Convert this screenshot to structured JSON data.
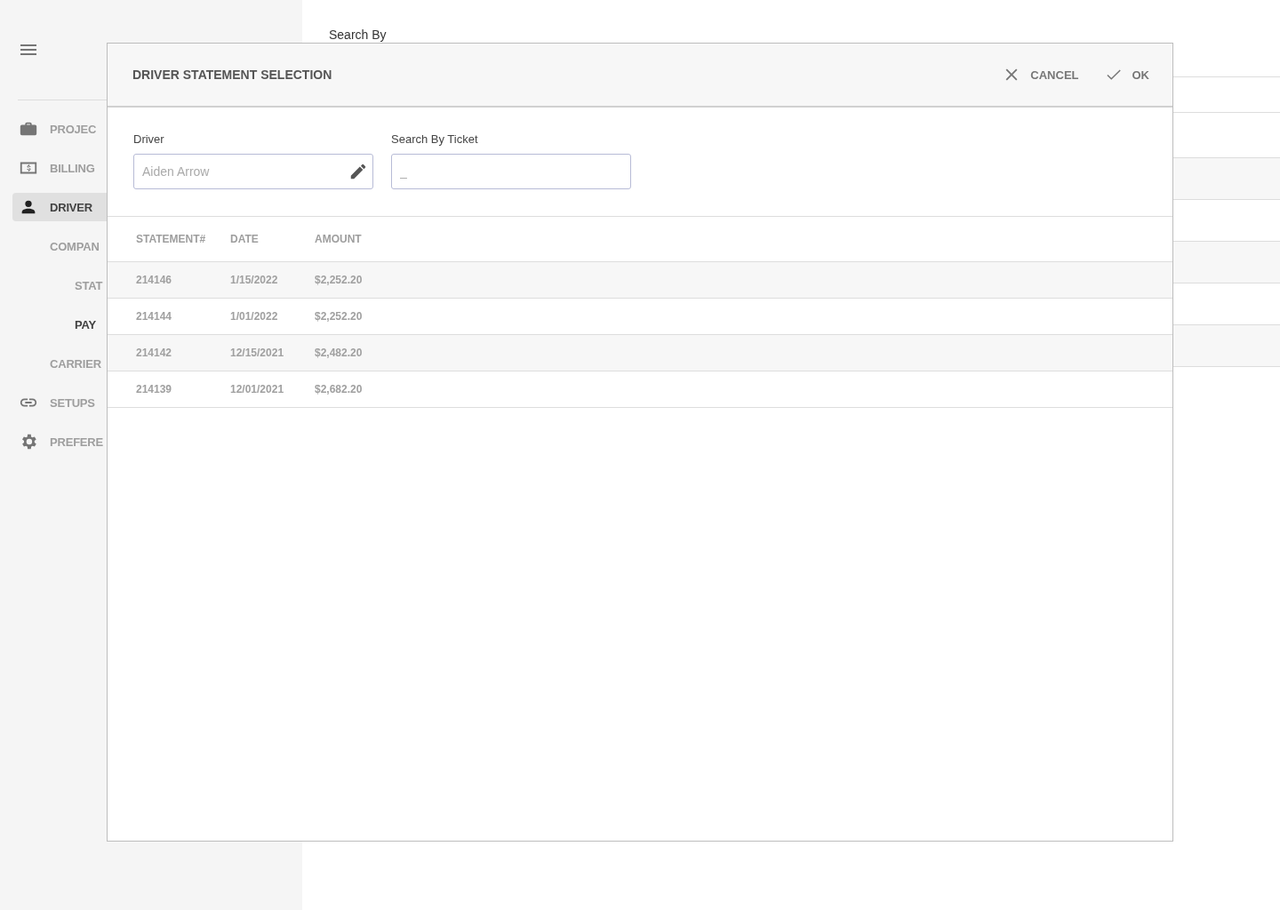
{
  "sidebar": {
    "items": [
      {
        "label": "PROJEC",
        "kind": "top",
        "selected": false
      },
      {
        "label": "BILLING",
        "kind": "top",
        "selected": false
      },
      {
        "label": "DRIVER",
        "kind": "top",
        "selected": true
      },
      {
        "label": "COMPAN",
        "kind": "group",
        "selected": false
      },
      {
        "label": "STAT",
        "kind": "sub",
        "selected": false
      },
      {
        "label": "PAY",
        "kind": "sub",
        "selected": true
      },
      {
        "label": "CARRIER",
        "kind": "sub-group",
        "selected": false
      },
      {
        "label": "SETUPS",
        "kind": "top",
        "selected": false
      },
      {
        "label": "PREFERE",
        "kind": "top",
        "selected": false
      }
    ]
  },
  "main": {
    "search_label": "Search By"
  },
  "dialog": {
    "title": "DRIVER STATEMENT SELECTION",
    "actions": [
      {
        "kind": "cancel",
        "label": "CANCEL"
      },
      {
        "kind": "ok",
        "label": "OK"
      }
    ],
    "fields": [
      {
        "label": "Driver",
        "placeholder": "Aiden Arrow",
        "kind": "edit"
      },
      {
        "label": "Search By Ticket",
        "placeholder": "_",
        "kind": "plain"
      }
    ],
    "table": {
      "columns": [
        "STATEMENT#",
        "DATE",
        "AMOUNT"
      ],
      "rows": [
        {
          "cells": [
            "214146",
            "1/15/2022",
            "$2,252.20"
          ]
        },
        {
          "cells": [
            "214144",
            "1/01/2022",
            "$2,252.20"
          ]
        },
        {
          "cells": [
            "214142",
            "12/15/2021",
            "$2,482.20"
          ]
        },
        {
          "cells": [
            "214139",
            "12/01/2021",
            "$2,682.20"
          ]
        }
      ]
    }
  }
}
